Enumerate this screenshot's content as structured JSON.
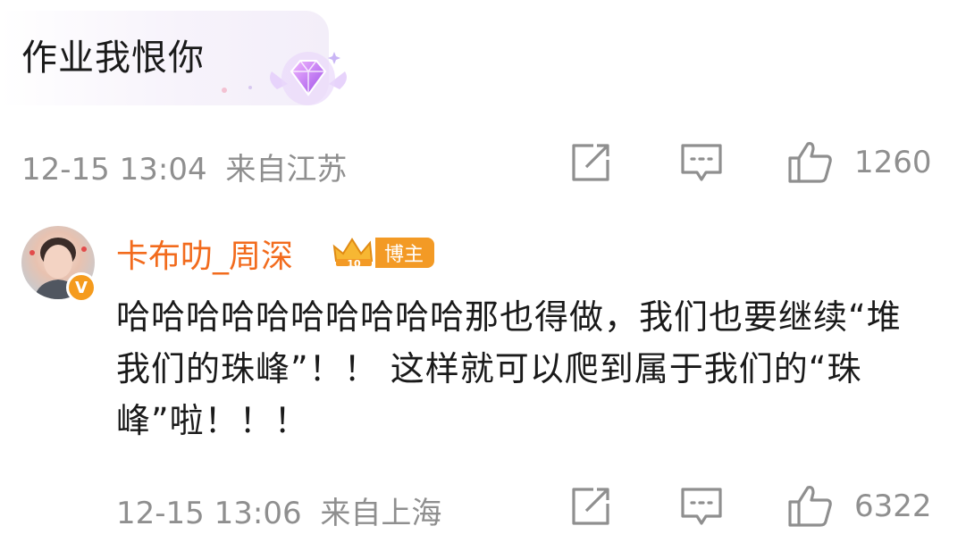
{
  "top_comment": {
    "text": "作业我恨你",
    "timestamp": "12-15 13:04",
    "location": "来自江苏",
    "likes": "1260",
    "badge_icon": "purple-diamond-badge"
  },
  "reply": {
    "username": "卡布叻_周深",
    "verified_mark": "V",
    "level_badge": "10",
    "role_tag": "博主",
    "text": "哈哈哈哈哈哈哈哈哈哈那也得做，我们也要继续“堆我们的珠峰”！！ 这样就可以爬到属于我们的“珠峰”啦！！！",
    "timestamp": "12-15 13:06",
    "location": "来自上海",
    "likes": "6322"
  },
  "colors": {
    "username": "#f26b1d",
    "meta_gray": "#8f8f8f",
    "tag_orange": "#f39a25"
  }
}
